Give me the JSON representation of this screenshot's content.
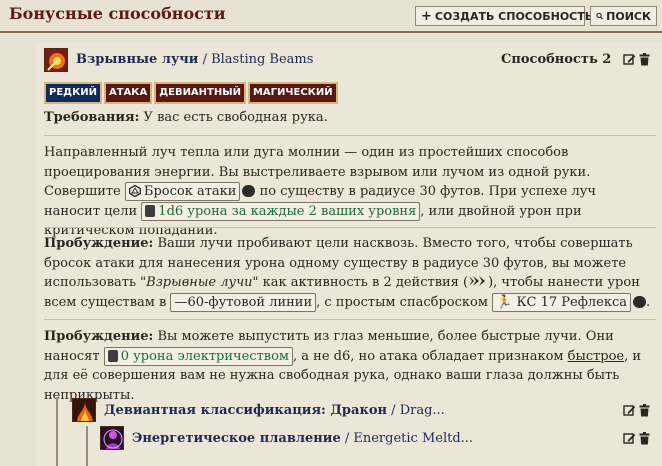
{
  "header": {
    "title": "Бонусные способности",
    "create_label": "СОЗДАТЬ СПОСОБНОСТЬ",
    "search_label": "ПОИСК"
  },
  "feat": {
    "name_ru": "Взрывные лучи",
    "name_sep": " / ",
    "name_en": "Blasting Beams",
    "level_label": "Способность 2",
    "traits": [
      "РЕДКИЙ",
      "АТАКА",
      "ДЕВИАНТНЫЙ",
      "МАГИЧЕСКИЙ"
    ],
    "requirements_label": "Требования:",
    "requirements_text": " У вас есть свободная рука.",
    "desc": {
      "t1": "Направленный луч тепла или дуга молнии — один из простейших способов проецирования энергии. Вы выстреливаете взрывом или лучом из одной руки. Совершите ",
      "attack_roll": "Бросок атаки",
      "t2": " по существу в радиусе 30 футов. При успехе луч наносит цели ",
      "damage": "1d6 урона за каждые 2 ваших уровня",
      "t3": ", или двойной урон при критическом попадании."
    },
    "awaken1": {
      "label": "Пробуждение:",
      "t1": " Ваши лучи пробивают цели насквозь. Вместо того, чтобы совершать бросок атаки для нанесения урона одному существу в радиусе 30 футов, вы можете использовать ",
      "quote": "\"Взрывные лучи\"",
      "t2": " как активность в 2 действия (",
      "t3": "), чтобы нанести урон всем существам в ",
      "line": "60-футовой линии",
      "t4": ", с простым спасброском ",
      "save": "КС 17 Рефлекса"
    },
    "awaken2": {
      "label": "Пробуждение:",
      "t1": " Вы можете выпустить из глаз меньшие, более быстрые лучи. Они наносят ",
      "damage": "0 урона электричеством",
      "t2": ", а не d6, но атака обладает признаком ",
      "trait_link": "быстрое",
      "t3": ", и для её совершения вам не нужна свободная рука, однако ваши глаза должны быть неприкрыты."
    }
  },
  "children": [
    {
      "name_ru": "Девиантная классификация: Дракон",
      "name_sep": " / ",
      "name_en": "Drag..."
    },
    {
      "name_ru": "Энергетическое плавление",
      "name_sep": " / ",
      "name_en": "Energetic Meltd..."
    }
  ]
}
